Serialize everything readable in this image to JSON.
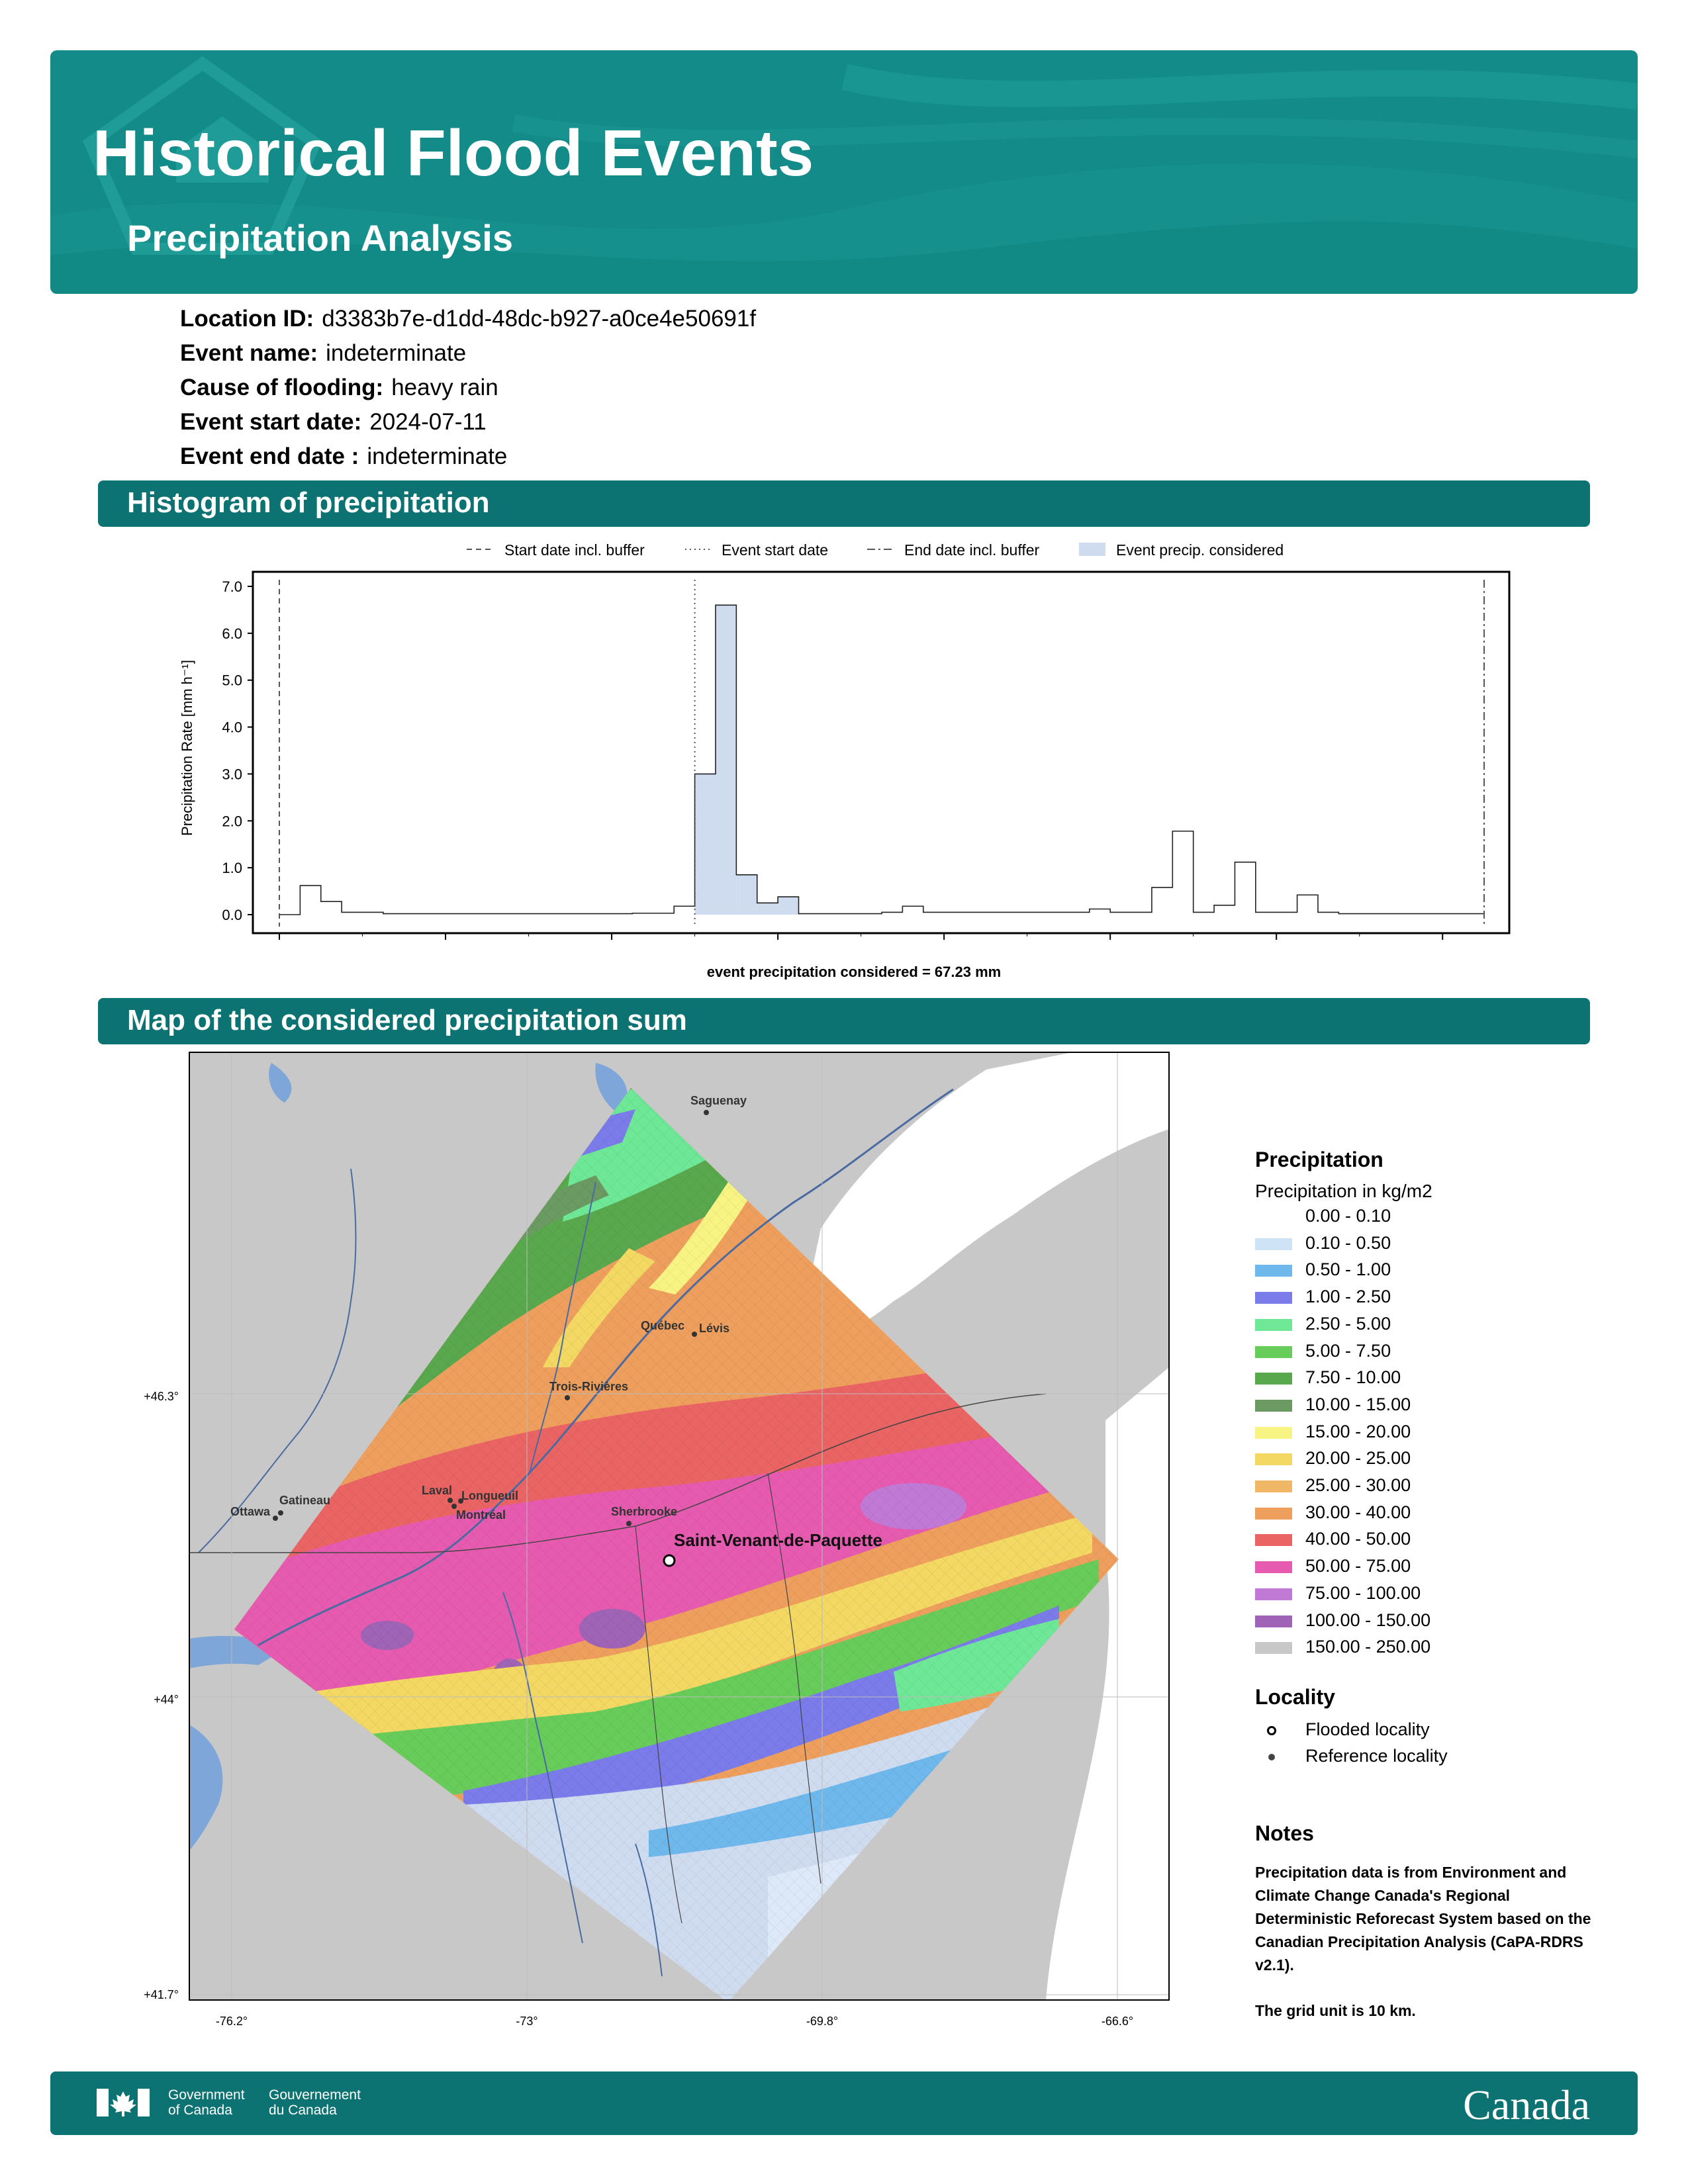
{
  "header": {
    "title": "Historical Flood Events",
    "subtitle": "Precipitation Analysis"
  },
  "info": [
    {
      "label": "Location ID:",
      "value": "d3383b7e-d1dd-48dc-b927-a0ce4e50691f"
    },
    {
      "label": "Event name:",
      "value": "indeterminate"
    },
    {
      "label": "Cause of flooding:",
      "value": "heavy rain"
    },
    {
      "label": "Event start date:",
      "value": "2024-07-11"
    },
    {
      "label": "Event end date :",
      "value": "indeterminate"
    }
  ],
  "sections": {
    "histogram": "Histogram of precipitation",
    "map": "Map of the considered precipitation sum"
  },
  "chart_data": {
    "type": "bar",
    "ylabel": "Precipitation Rate [mm h⁻¹]",
    "ylim": [
      0,
      7
    ],
    "yticks": [
      "0.0",
      "1.0",
      "2.0",
      "3.0",
      "4.0",
      "5.0",
      "6.0",
      "7.0"
    ],
    "legend": [
      "Start date incl. buffer",
      "Event start date",
      "End date incl. buffer",
      "Event precip. considered"
    ],
    "legend_placement": "top",
    "values": [
      0.0,
      0.62,
      0.28,
      0.05,
      0.05,
      0.02,
      0.02,
      0.02,
      0.02,
      0.02,
      0.02,
      0.02,
      0.02,
      0.02,
      0.02,
      0.02,
      0.02,
      0.03,
      0.03,
      0.18,
      3.0,
      6.6,
      0.85,
      0.25,
      0.38,
      0.02,
      0.02,
      0.02,
      0.02,
      0.05,
      0.18,
      0.05,
      0.05,
      0.05,
      0.05,
      0.05,
      0.05,
      0.05,
      0.05,
      0.12,
      0.05,
      0.05,
      0.58,
      1.78,
      0.05,
      0.2,
      1.12,
      0.05,
      0.05,
      0.42,
      0.05,
      0.02,
      0.02,
      0.02,
      0.02,
      0.02,
      0.02,
      0.02
    ],
    "start_buffer_index": 0,
    "event_start_index": 20,
    "end_buffer_index": 57,
    "considered_range": [
      20,
      24
    ],
    "annotation": "event precipitation considered = 67.23 mm"
  },
  "map": {
    "lat_labels": [
      "+46.3°",
      "+44°",
      "+41.7°"
    ],
    "lon_labels": [
      "-76.2°",
      "-73°",
      "-69.8°",
      "-66.6°"
    ],
    "cities": [
      {
        "name": "Saguenay"
      },
      {
        "name": "Québec"
      },
      {
        "name": "Lévis"
      },
      {
        "name": "Trois-Rivières"
      },
      {
        "name": "Gatineau"
      },
      {
        "name": "Ottawa"
      },
      {
        "name": "Laval"
      },
      {
        "name": "Longueuil"
      },
      {
        "name": "Montréal"
      },
      {
        "name": "Sherbrooke"
      }
    ],
    "flooded_locality": "Saint-Venant-de-Paquette"
  },
  "legend": {
    "title": "Precipitation",
    "subtitle": "Precipitation in kg/m2",
    "items": [
      {
        "label": "0.00 - 0.10",
        "color": "#ffffff"
      },
      {
        "label": "0.10 - 0.50",
        "color": "#cfe3f7"
      },
      {
        "label": "0.50 - 1.00",
        "color": "#6fb8ec"
      },
      {
        "label": "1.00 - 2.50",
        "color": "#7b7bea"
      },
      {
        "label": "2.50 - 5.00",
        "color": "#6ee897"
      },
      {
        "label": "5.00 - 7.50",
        "color": "#68cc5a"
      },
      {
        "label": "7.50 - 10.00",
        "color": "#5aa84e"
      },
      {
        "label": "10.00 - 15.00",
        "color": "#6b9a62"
      },
      {
        "label": "15.00 - 20.00",
        "color": "#f8f483"
      },
      {
        "label": "20.00 - 25.00",
        "color": "#f3d863"
      },
      {
        "label": "25.00 - 30.00",
        "color": "#f0b866"
      },
      {
        "label": "30.00 - 40.00",
        "color": "#ee9f5d"
      },
      {
        "label": "40.00 - 50.00",
        "color": "#ea6464"
      },
      {
        "label": "50.00 - 75.00",
        "color": "#e65bb0"
      },
      {
        "label": "75.00 - 100.00",
        "color": "#c07ad6"
      },
      {
        "label": "100.00 - 150.00",
        "color": "#9f64b5"
      },
      {
        "label": "150.00 - 250.00",
        "color": "#c8c8c8"
      }
    ],
    "locality_title": "Locality",
    "flooded_label": "Flooded locality",
    "reference_label": "Reference locality"
  },
  "notes": {
    "title": "Notes",
    "p1": "Precipitation data is from Environment and Climate Change Canada's Regional Deterministic Reforecast System based on the Canadian Precipitation Analysis (CaPA-RDRS v2.1).",
    "p2": "The grid unit is 10 km."
  },
  "footer": {
    "gov_en_1": "Government",
    "gov_en_2": "of Canada",
    "gov_fr_1": "Gouvernement",
    "gov_fr_2": "du Canada",
    "wordmark": "Canada"
  }
}
